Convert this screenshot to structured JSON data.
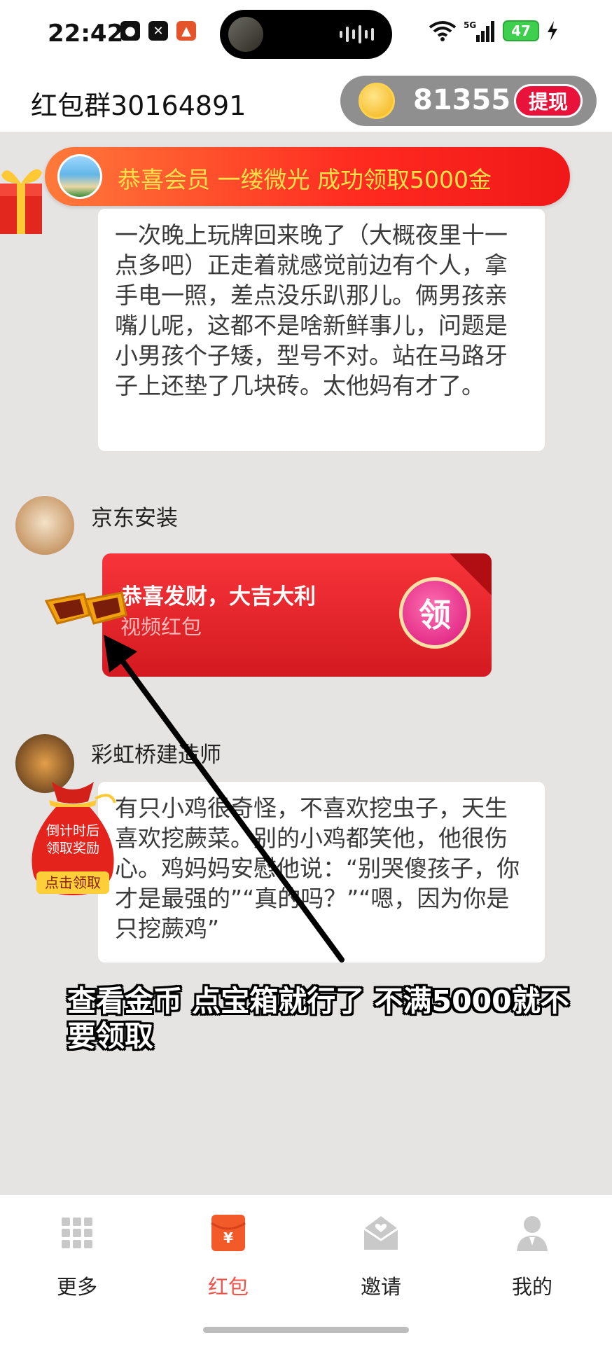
{
  "status_bar": {
    "time": "22:42",
    "battery": "47",
    "network": "5G"
  },
  "header": {
    "title": "红包群30164891",
    "coins": "81355",
    "withdraw_label": "提现"
  },
  "banner": {
    "text": "恭喜会员 一缕微光 成功领取5000金"
  },
  "messages": [
    {
      "text": "一次晚上玩牌回来晚了（大概夜里十一点多吧）正走着就感觉前边有个人，拿手电一照，差点没乐趴那儿。俩男孩亲嘴儿呢，这都不是啥新鲜事儿，问题是小男孩个子矮，型号不对。站在马路牙子上还垫了几块砖。太他妈有才了。"
    },
    {
      "sender": "京东安装",
      "redpacket_title": "恭喜发财，大吉大利",
      "redpacket_sub": "视频红包",
      "claim_label": "领"
    },
    {
      "sender": "彩虹桥建造师",
      "text": "有只小鸡很奇怪，不喜欢挖虫子，天生喜欢挖蕨菜。别的小鸡都笑他，他很伤心。鸡妈妈安慰他说：“别哭傻孩子，你才是最强的”“真的吗？”“嗯，因为你是只挖蕨鸡”"
    }
  ],
  "moneybag": {
    "line1": "倒计时后",
    "line2": "领取奖励",
    "button": "点击领取"
  },
  "overlay_caption": "查看金币 点宝箱就行了 不满5000就不要领取",
  "tabs": [
    {
      "label": "更多",
      "icon": "grid-icon",
      "active": false
    },
    {
      "label": "红包",
      "icon": "red-envelope-icon",
      "active": true
    },
    {
      "label": "邀请",
      "icon": "invite-envelope-icon",
      "active": false
    },
    {
      "label": "我的",
      "icon": "profile-icon",
      "active": false
    }
  ],
  "colors": {
    "accent": "#f25a2a",
    "tab_active": "#f0524a",
    "red": "#e8123a"
  }
}
